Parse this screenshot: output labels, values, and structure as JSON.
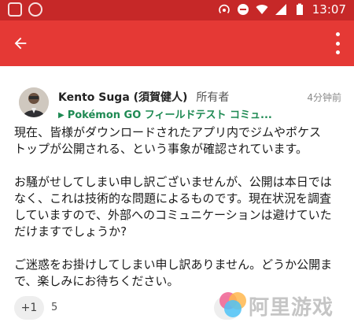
{
  "status_bar": {
    "time": "13:07",
    "icons": [
      "notification-icon",
      "android-icon",
      "hotspot-icon",
      "do-not-disturb-icon",
      "wifi-icon",
      "signal-icon",
      "battery-icon"
    ]
  },
  "app_bar": {
    "color": "#e53935",
    "icons": [
      "back-arrow-icon",
      "more-vert-icon"
    ]
  },
  "post": {
    "author": "Kento Suga (須賀健人)",
    "role": "所有者",
    "time": "4分钟前",
    "community": "Pokémon GO フィールドテスト コミュ...",
    "paragraph1": "現在、皆様がダウンロードされたアプリ内でジムやポケス\nトップが公開される、という事象が確認されています。",
    "paragraph2": "お騒がせしてしまい申し訳ございませんが、公開は本日では\nなく、これは技術的な問題によるものです。現在状況を調査\nしていますので、外部へのコミュニケーションは避けていた\nだけますでしょうか?",
    "paragraph3": "ご迷惑をお掛けしてしまい申し訳ありません。どうか公開ま\nで、楽しみにお待ちください。"
  },
  "actions": {
    "plus_one_label": "+1",
    "plus_one_count": "5"
  },
  "watermark": {
    "text": "阿里游戏"
  }
}
